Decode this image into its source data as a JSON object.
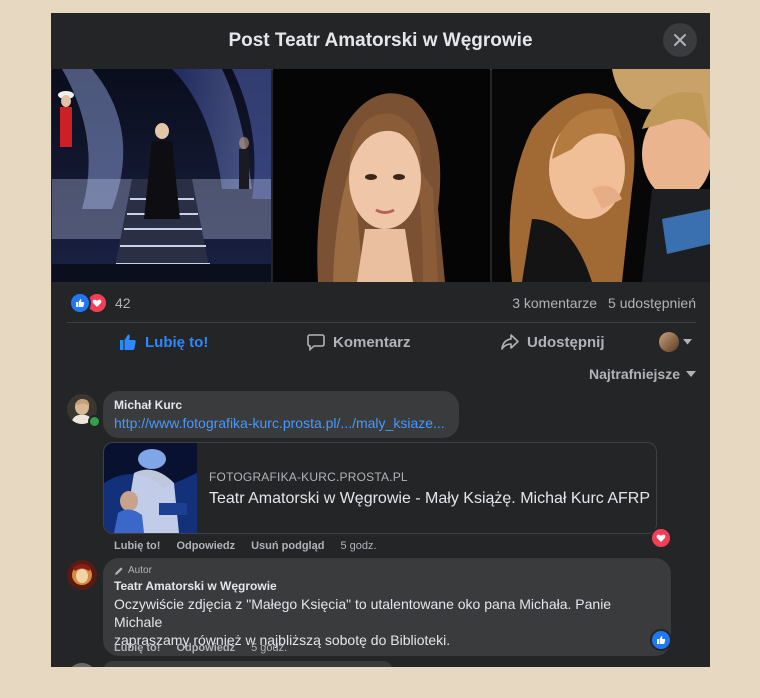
{
  "header": {
    "title": "Post Teatr Amatorski w Węgrowie"
  },
  "photos": [
    {
      "name": "stage-photo",
      "alt": ""
    },
    {
      "name": "portrait-photo",
      "alt": ""
    },
    {
      "name": "couple-photo",
      "alt": ""
    }
  ],
  "stats": {
    "reaction_count": "42",
    "comments": "3 komentarze",
    "shares": "5 udostępnień"
  },
  "actions": {
    "like": "Lubię to!",
    "comment": "Komentarz",
    "share": "Udostępnij"
  },
  "sort": {
    "label": "Najtrafniejsze"
  },
  "comments": [
    {
      "author": "Michał Kurc",
      "link": "http://www.fotografika-kurc.prosta.pl/.../maly_ksiaze...",
      "preview_domain": "FOTOGRAFIKA-KURC.PROSTA.PL",
      "preview_title": "Teatr Amatorski w Węgrowie - Mały Książę. Michał Kurc  AFRP",
      "meta": {
        "like": "Lubię to!",
        "reply": "Odpowiedz",
        "remove_preview": "Usuń podgląd",
        "time": "5 godz."
      }
    },
    {
      "author_tag": "Autor",
      "author": "Teatr Amatorski w Węgrowie",
      "text_line1": "Oczywiście zdjęcia z \"Małego Księcia\" to utalentowane oko pana Michała. Panie Michale",
      "text_line2": "zapraszamy również w najbliższą sobotę do Biblioteki.",
      "meta": {
        "like": "Lubię to!",
        "reply": "Odpowiedz",
        "time": "5 godz."
      }
    }
  ],
  "colors": {
    "background": "#242526",
    "accent": "#2d88ff",
    "love": "#f33e58",
    "page": "#e7d8c2"
  }
}
